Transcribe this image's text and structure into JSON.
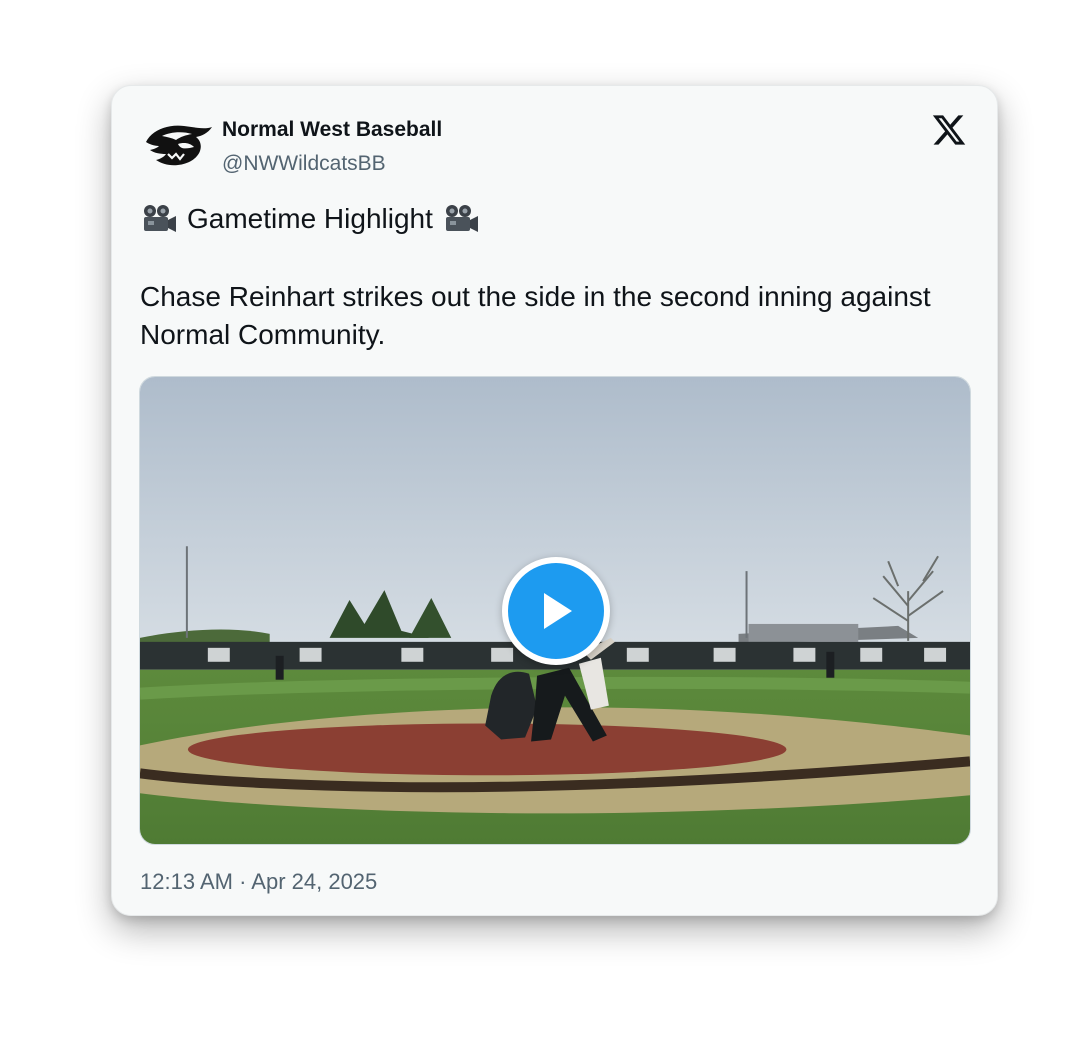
{
  "tweet": {
    "author": {
      "display_name": "Normal West Baseball",
      "handle": "@NWWildcatsBB",
      "avatar_icon": "wildcat-head-logo-icon"
    },
    "platform_icon": "x-logo-icon",
    "title_line": "Gametime Highlight",
    "emoji_icon": "movie-camera-icon",
    "body": "Chase Reinhart strikes out the side in the second inning against Normal Community.",
    "media": {
      "type": "video",
      "play_icon": "play-icon"
    },
    "timestamp": "12:13 AM · Apr 24, 2025"
  },
  "colors": {
    "card_bg": "#f7f9f9",
    "text_primary": "#0f1419",
    "text_secondary": "#536471",
    "accent_blue": "#1d9bf0"
  }
}
